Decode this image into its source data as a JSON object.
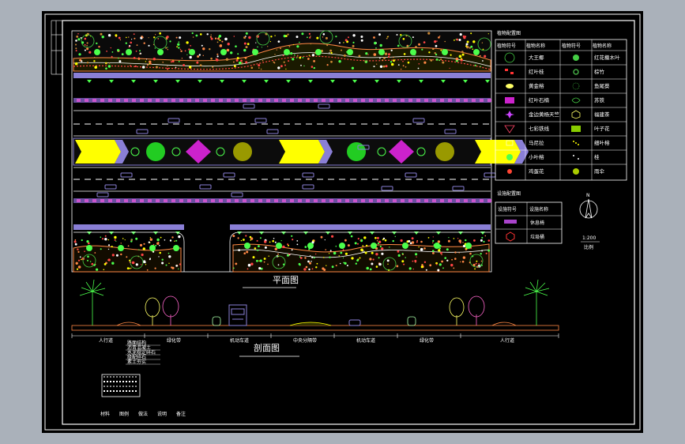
{
  "titles": {
    "plan": "平面图",
    "section": "剖面图",
    "plant_table": "植物配置图",
    "facility_table": "设施配置图"
  },
  "plant_table": {
    "headers": [
      "植物符号",
      "植物名称",
      "植物符号",
      "植物名称"
    ],
    "left": [
      {
        "name": "大王椰",
        "icon": "palm-circle-icon"
      },
      {
        "name": "红叶桂",
        "icon": "red-dots-icon"
      },
      {
        "name": "黄金榕",
        "icon": "yellow-shrub-icon"
      },
      {
        "name": "红叶石楠",
        "icon": "magenta-grid-icon"
      },
      {
        "name": "金边黄杨天竺",
        "icon": "purple-star-icon"
      },
      {
        "name": "七彩铁线",
        "icon": "triangle-icon"
      },
      {
        "name": "马尼拉",
        "icon": "grass-icon"
      },
      {
        "name": "小叶榕",
        "icon": "green-ball-icon"
      },
      {
        "name": "鸡蛋花",
        "icon": "red-flower-icon"
      }
    ],
    "right": [
      {
        "name": "红花檵木叶",
        "icon": "green-ring-icon"
      },
      {
        "name": "棕竹",
        "icon": "green-burst-icon"
      },
      {
        "name": "鱼尾葵",
        "icon": "spiky-icon"
      },
      {
        "name": "苏铁",
        "icon": "cycad-icon"
      },
      {
        "name": "福建茶",
        "icon": "hexagon-icon"
      },
      {
        "name": "叶子花",
        "icon": "yellow-box-icon"
      },
      {
        "name": "细叶榕",
        "icon": "yellow-dots-icon"
      },
      {
        "name": "桂",
        "icon": "white-dots-icon"
      },
      {
        "name": "雨伞",
        "icon": "yellow-circle-icon"
      }
    ]
  },
  "facility_table": {
    "headers": [
      "设施符号",
      "设施名称"
    ],
    "rows": [
      {
        "name": "休息椅",
        "icon": "bench-icon"
      },
      {
        "name": "垃圾桶",
        "icon": "bin-icon"
      }
    ]
  },
  "north": {
    "letter": "N"
  },
  "scale": {
    "ratio": "1:200",
    "label": "比例"
  },
  "section_labels": [
    "人行道",
    "绿化带",
    "机动车道",
    "中央分隔带",
    "机动车道",
    "绿化带",
    "人行道"
  ],
  "notes": [
    "路面结构",
    "沥青混凝土",
    "水泥稳定碎石",
    "级配碎石",
    "素土夯实"
  ],
  "legend_row": [
    "材料",
    "图例",
    "做法",
    "说明",
    "备注"
  ],
  "colors": {
    "background": "#000000",
    "frame": "#ffffff",
    "road_purple": "#8a7fd6",
    "green": "#4cff4c",
    "orange": "#ff8844",
    "yellow": "#ffff00",
    "magenta": "#cc22cc",
    "red": "#ff2222"
  }
}
